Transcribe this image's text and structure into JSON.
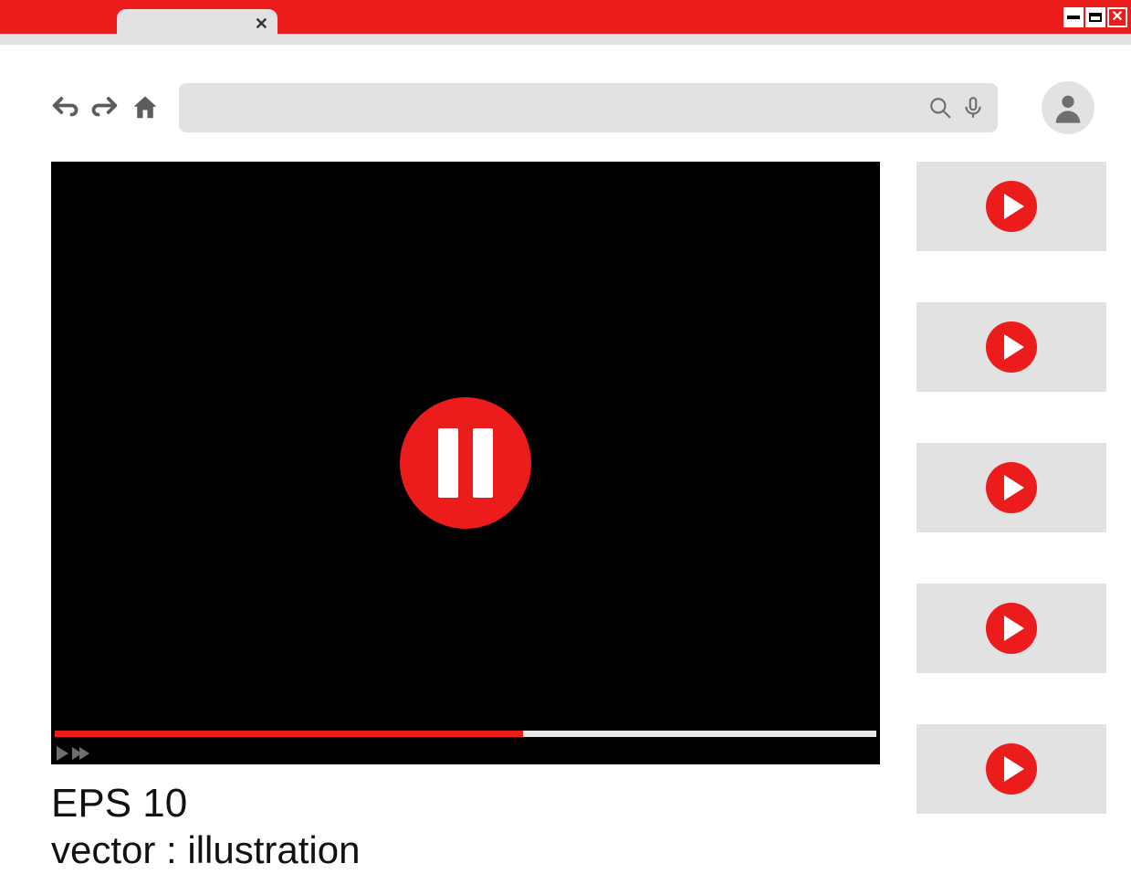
{
  "window": {
    "tab_close_glyph": "✕",
    "controls": {
      "min": "–",
      "max": "▢",
      "close": "✕"
    }
  },
  "toolbar": {
    "search_value": "",
    "search_placeholder": ""
  },
  "player": {
    "state": "paused",
    "progress_percent": 57
  },
  "video": {
    "title": "EPS 10",
    "subtitle": "vector :  illustration"
  },
  "sidebar": {
    "thumbs": [
      {
        "id": 1
      },
      {
        "id": 2
      },
      {
        "id": 3
      },
      {
        "id": 4
      },
      {
        "id": 5
      }
    ]
  },
  "colors": {
    "accent": "#ed1c1c",
    "panel": "#e2e2e2",
    "icon": "#6f6f6f"
  }
}
